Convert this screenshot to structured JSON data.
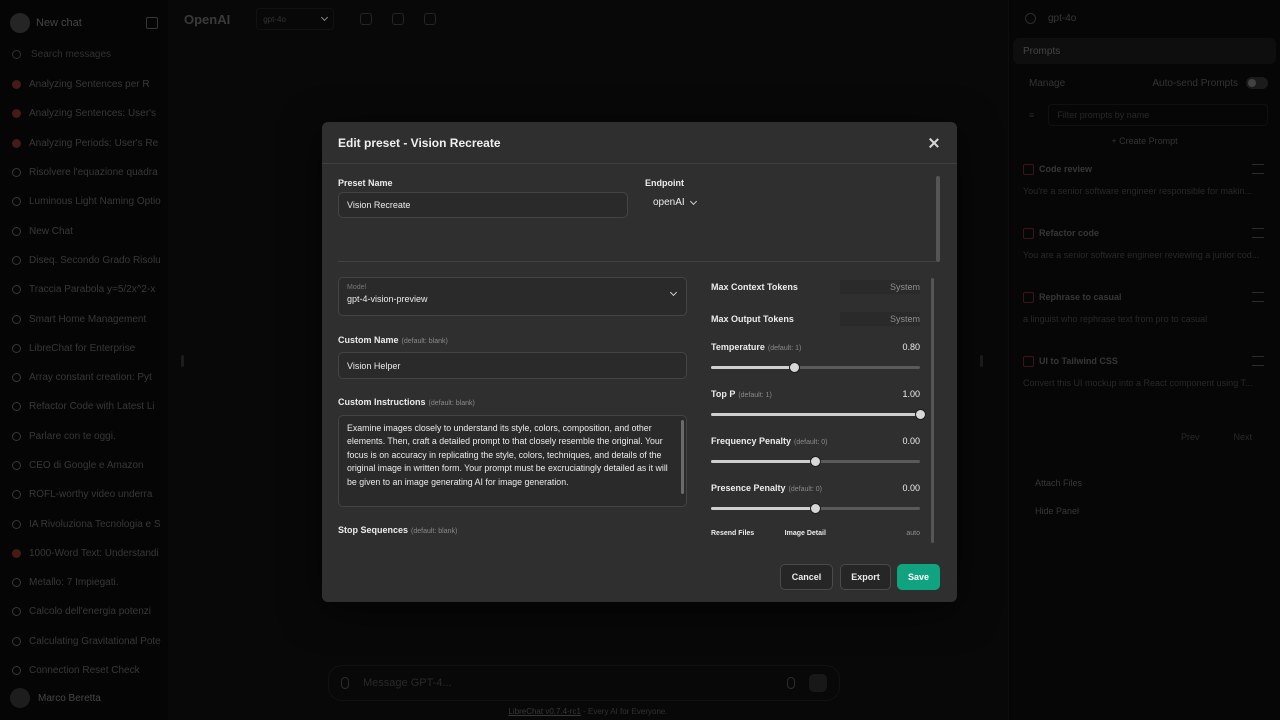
{
  "sidebar": {
    "new_chat": "New chat",
    "search_placeholder": "Search messages",
    "items": [
      {
        "label": "Analyzing Sentences per R",
        "red": true
      },
      {
        "label": "Analyzing Sentences: User's",
        "red": true
      },
      {
        "label": "Analyzing Periods: User's Re",
        "red": true
      },
      {
        "label": "Risolvere l'equazione quadra",
        "red": false
      },
      {
        "label": "Luminous Light Naming Optio",
        "red": false
      },
      {
        "label": "New Chat",
        "red": false
      },
      {
        "label": "Diseq. Secondo Grado Risolu",
        "red": false
      },
      {
        "label": "Traccia Parabola y=5/2x^2-x",
        "red": false
      },
      {
        "label": "Smart Home Management",
        "red": false
      },
      {
        "label": "LibreChat for Enterprise",
        "red": false
      },
      {
        "label": "Array constant creation: Pyt",
        "red": false
      },
      {
        "label": "Refactor Code with Latest Li",
        "red": false
      },
      {
        "label": "Parlare con te oggi.",
        "red": false
      },
      {
        "label": "CEO di Google e Amazon",
        "red": false
      },
      {
        "label": "ROFL-worthy video underra",
        "red": false
      },
      {
        "label": "IA Rivoluziona Tecnologia e S",
        "red": false
      },
      {
        "label": "1000-Word Text: Understandi",
        "red": true
      },
      {
        "label": "Metallo: 7 Impiegati.",
        "red": false
      },
      {
        "label": "Calcolo dell'energia potenzi",
        "red": false
      },
      {
        "label": "Calculating Gravitational Pote",
        "red": false
      },
      {
        "label": "Connection Reset Check",
        "red": false
      }
    ],
    "user": "Marco Beretta"
  },
  "topbar": {
    "endpoint": "OpenAI",
    "model": "gpt-4o"
  },
  "composer": {
    "placeholder": "Message GPT-4..."
  },
  "footer": {
    "link": "LibreChat v0.7.4-rc1",
    "text": " - Every AI for Everyone."
  },
  "right_panel": {
    "model": "gpt-4o",
    "prompts_label": "Prompts",
    "manage": "Manage",
    "auto_send": "Auto-send Prompts",
    "filter_placeholder": "Filter prompts by name",
    "create": "+ Create Prompt",
    "cards": [
      {
        "title": "Code review",
        "desc": "You're a senior software engineer responsible for makin..."
      },
      {
        "title": "Refactor code",
        "desc": "You are a senior software engineer reviewing a junior cod..."
      },
      {
        "title": "Rephrase to casual",
        "desc": "a linguist who rephrase text from pro to casual"
      },
      {
        "title": "UI to Tailwind CSS",
        "desc": "Convert this UI mockup into a React component using T..."
      }
    ],
    "prev": "Prev",
    "next": "Next",
    "attach": "Attach Files",
    "hide": "Hide Panel"
  },
  "modal": {
    "title": "Edit preset - Vision Recreate",
    "preset_name_label": "Preset Name",
    "preset_name_value": "Vision Recreate",
    "endpoint_label": "Endpoint",
    "endpoint_value": "openAI",
    "model_small": "Model",
    "model_value": "gpt-4-vision-preview",
    "custom_name_label": "Custom Name",
    "default_blank": "(default: blank)",
    "custom_name_value": "Vision Helper",
    "custom_instructions_label": "Custom Instructions",
    "custom_instructions_value": "Examine images closely to understand its style, colors, composition, and other elements. Then, craft a detailed prompt to that closely resemble the original. Your focus is on accuracy in replicating the style, colors, techniques, and details of the original image in written form. Your prompt must be excruciatingly detailed as it will be given to an image generating AI for image generation.",
    "stop_sequences_label": "Stop Sequences",
    "max_context_label": "Max Context Tokens",
    "max_context_value": "System",
    "max_output_label": "Max Output Tokens",
    "max_output_value": "System",
    "sliders": [
      {
        "label": "Temperature",
        "default": "(default: 1)",
        "value": "0.80",
        "fraction": 0.4
      },
      {
        "label": "Top P",
        "default": "(default: 1)",
        "value": "1.00",
        "fraction": 1.0
      },
      {
        "label": "Frequency Penalty",
        "default": "(default: 0)",
        "value": "0.00",
        "fraction": 0.5
      },
      {
        "label": "Presence Penalty",
        "default": "(default: 0)",
        "value": "0.00",
        "fraction": 0.5
      }
    ],
    "resend_files": "Resend Files",
    "image_detail": "Image Detail",
    "image_detail_value": "auto",
    "cancel": "Cancel",
    "export": "Export",
    "save": "Save"
  }
}
